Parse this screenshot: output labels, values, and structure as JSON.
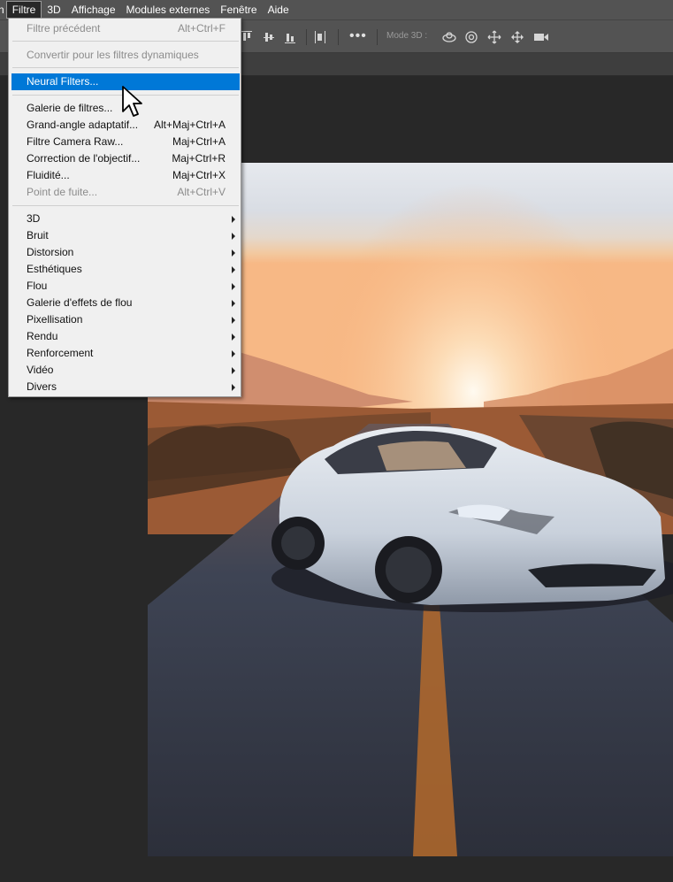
{
  "menubar": {
    "items": [
      {
        "label": "n"
      },
      {
        "label": "Filtre"
      },
      {
        "label": "3D"
      },
      {
        "label": "Affichage"
      },
      {
        "label": "Modules externes"
      },
      {
        "label": "Fenêtre"
      },
      {
        "label": "Aide"
      }
    ],
    "active_index": 1
  },
  "options_bar": {
    "more_label": "•••",
    "mode3d_label": "Mode 3D :",
    "icons": [
      "align-top-icon",
      "align-vcenter-icon",
      "align-bottom-icon",
      "distribute-icon",
      "more-icon",
      "orbit-3d-icon",
      "roll-3d-icon",
      "pan-3d-icon",
      "slide-3d-icon",
      "scale-3d-icon"
    ]
  },
  "filter_menu": {
    "sections": [
      [
        {
          "label": "Filtre précédent",
          "shortcut": "Alt+Ctrl+F",
          "disabled": true
        }
      ],
      [
        {
          "label": "Convertir pour les filtres dynamiques",
          "shortcut": "",
          "disabled": true
        }
      ],
      [
        {
          "label": "Neural Filters...",
          "shortcut": "",
          "highlighted": true
        }
      ],
      [
        {
          "label": "Galerie de filtres...",
          "shortcut": ""
        },
        {
          "label": "Grand-angle adaptatif...",
          "shortcut": "Alt+Maj+Ctrl+A"
        },
        {
          "label": "Filtre Camera Raw...",
          "shortcut": "Maj+Ctrl+A"
        },
        {
          "label": "Correction de l'objectif...",
          "shortcut": "Maj+Ctrl+R"
        },
        {
          "label": "Fluidité...",
          "shortcut": "Maj+Ctrl+X"
        },
        {
          "label": "Point de fuite...",
          "shortcut": "Alt+Ctrl+V",
          "disabled": true
        }
      ],
      [
        {
          "label": "3D",
          "submenu": true
        },
        {
          "label": "Bruit",
          "submenu": true
        },
        {
          "label": "Distorsion",
          "submenu": true
        },
        {
          "label": "Esthétiques",
          "submenu": true
        },
        {
          "label": "Flou",
          "submenu": true
        },
        {
          "label": "Galerie d'effets de flou",
          "submenu": true
        },
        {
          "label": "Pixellisation",
          "submenu": true
        },
        {
          "label": "Rendu",
          "submenu": true
        },
        {
          "label": "Renforcement",
          "submenu": true
        },
        {
          "label": "Vidéo",
          "submenu": true
        },
        {
          "label": "Divers",
          "submenu": true
        }
      ]
    ]
  },
  "canvas": {
    "image": "car-on-road-at-sunset-photo"
  },
  "colors": {
    "menubar_bg": "#535353",
    "menu_bg": "#f0f0f0",
    "highlight": "#0078d7",
    "workspace_bg": "#282828"
  }
}
